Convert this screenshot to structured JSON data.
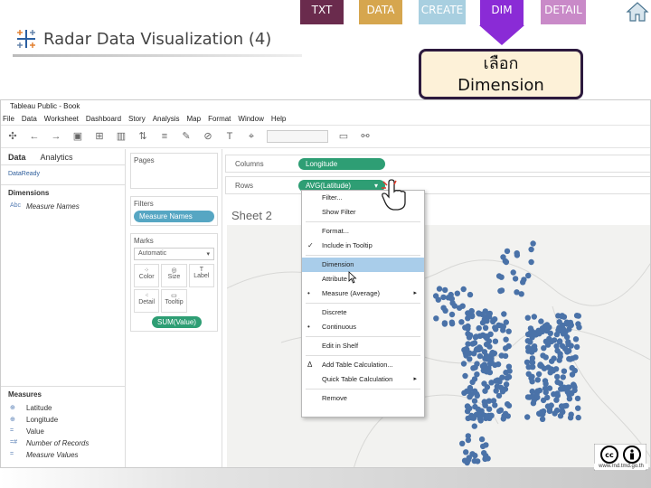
{
  "tabs": {
    "txt": "TXT",
    "data": "DATA",
    "create": "CREATE",
    "dim": "DIM",
    "detail": "DETAIL"
  },
  "slide": {
    "title": "Radar Data Visualization (4)"
  },
  "callout": {
    "line1": "เลือก",
    "line2": "Dimension"
  },
  "app": {
    "title": "Tableau Public - Book",
    "menu": [
      "File",
      "Data",
      "Worksheet",
      "Dashboard",
      "Story",
      "Analysis",
      "Map",
      "Format",
      "Window",
      "Help"
    ],
    "left_tabs": {
      "data": "Data",
      "analytics": "Analytics"
    },
    "datasource": "DataReady",
    "dimensions_label": "Dimensions",
    "dimensions": [
      {
        "prefix": "Abc",
        "name": "Measure Names"
      }
    ],
    "measures_label": "Measures",
    "measures": [
      {
        "prefix": "⊕",
        "name": "Latitude"
      },
      {
        "prefix": "⊕",
        "name": "Longitude"
      },
      {
        "prefix": "=",
        "name": "Value"
      },
      {
        "prefix": "=#",
        "name": "Number of Records"
      },
      {
        "prefix": "=",
        "name": "Measure Values"
      }
    ],
    "pages_label": "Pages",
    "filters_label": "Filters",
    "filter_pill": "Measure Names",
    "marks_label": "Marks",
    "marks_type": "Automatic",
    "marks_buttons": [
      "Color",
      "Size",
      "Label",
      "Detail",
      "Tooltip"
    ],
    "marks_pill": "SUM(Value)",
    "columns_label": "Columns",
    "columns_pill": "Longitude",
    "rows_label": "Rows",
    "rows_pill": "AVG(Latitude)",
    "sheet_title": "Sheet 2"
  },
  "context_menu": {
    "items": [
      {
        "label": "Filter...",
        "mark": "",
        "submenu": false,
        "highlight": false
      },
      {
        "label": "Show Filter",
        "mark": "",
        "submenu": false,
        "highlight": false
      },
      {
        "sep": true
      },
      {
        "label": "Format...",
        "mark": "",
        "submenu": false,
        "highlight": false
      },
      {
        "label": "Include in Tooltip",
        "mark": "✓",
        "submenu": false,
        "highlight": false
      },
      {
        "sep": true
      },
      {
        "label": "Dimension",
        "mark": "",
        "submenu": false,
        "highlight": true
      },
      {
        "label": "Attribute",
        "mark": "",
        "submenu": false,
        "highlight": false
      },
      {
        "label": "Measure (Average)",
        "mark": "•",
        "submenu": true,
        "highlight": false
      },
      {
        "sep": true
      },
      {
        "label": "Discrete",
        "mark": "",
        "submenu": false,
        "highlight": false
      },
      {
        "label": "Continuous",
        "mark": "•",
        "submenu": false,
        "highlight": false
      },
      {
        "sep": true
      },
      {
        "label": "Edit in Shelf",
        "mark": "",
        "submenu": false,
        "highlight": false
      },
      {
        "sep": true
      },
      {
        "label": "Add Table Calculation...",
        "mark": "Δ",
        "submenu": false,
        "highlight": false
      },
      {
        "label": "Quick Table Calculation",
        "mark": "",
        "submenu": true,
        "highlight": false
      },
      {
        "sep": true
      },
      {
        "label": "Remove",
        "mark": "",
        "submenu": false,
        "highlight": false
      }
    ]
  },
  "license": {
    "url": "www.rnd.tmd.go.th"
  },
  "colors": {
    "dim_tab": "#8a2bd6",
    "pill_green": "#2e9e74",
    "map_point": "#4a72a8",
    "highlight": "#a9cdea"
  },
  "icons": [
    "home-icon",
    "tableau-logo-icon",
    "hand-pointer-icon",
    "mouse-cursor-icon",
    "creative-commons-icon"
  ]
}
